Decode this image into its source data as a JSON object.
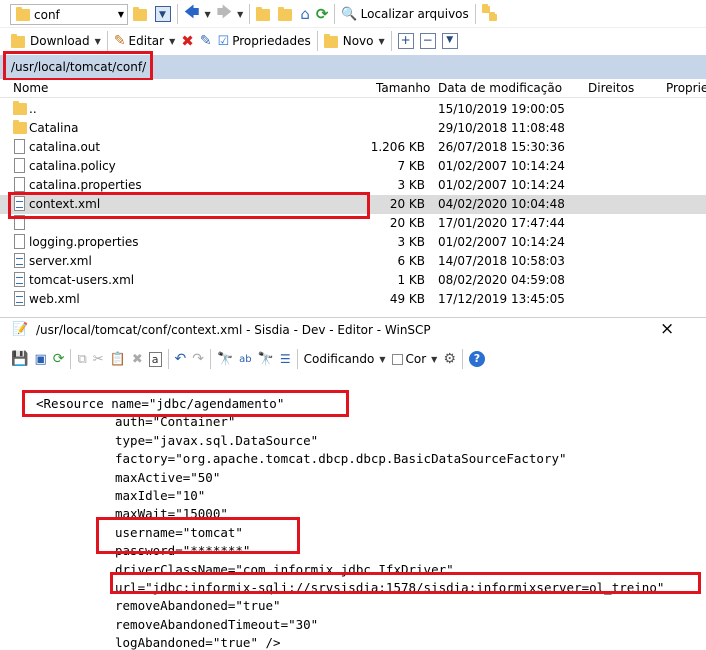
{
  "toolbar1": {
    "location": "conf",
    "find_files": "Localizar arquivos"
  },
  "toolbar2": {
    "download": "Download",
    "edit": "Editar",
    "properties": "Propriedades",
    "new": "Novo"
  },
  "path": "/usr/local/tomcat/conf/",
  "columns": {
    "name": "Nome",
    "size": "Tamanho",
    "modified": "Data de modificação",
    "rights": "Direitos",
    "owner": "Propriet"
  },
  "files": [
    {
      "name": "..",
      "size": "",
      "date": "15/10/2019 19:00:05",
      "kind": "parent"
    },
    {
      "name": "Catalina",
      "size": "",
      "date": "29/10/2018 11:08:48",
      "kind": "folder"
    },
    {
      "name": "catalina.out",
      "size": "1.206 KB",
      "date": "26/07/2018 15:30:36",
      "kind": "file"
    },
    {
      "name": "catalina.policy",
      "size": "7 KB",
      "date": "01/02/2007 10:14:24",
      "kind": "file"
    },
    {
      "name": "catalina.properties",
      "size": "3 KB",
      "date": "01/02/2007 10:14:24",
      "kind": "file"
    },
    {
      "name": "context.xml",
      "size": "20 KB",
      "date": "04/02/2020 10:04:48",
      "kind": "xml"
    },
    {
      "name": "",
      "size": "20 KB",
      "date": "17/01/2020 17:47:44",
      "kind": "file"
    },
    {
      "name": "logging.properties",
      "size": "3 KB",
      "date": "01/02/2007 10:14:24",
      "kind": "file"
    },
    {
      "name": "server.xml",
      "size": "6 KB",
      "date": "14/07/2018 10:58:03",
      "kind": "xml"
    },
    {
      "name": "tomcat-users.xml",
      "size": "1 KB",
      "date": "08/02/2020 04:59:08",
      "kind": "xml"
    },
    {
      "name": "web.xml",
      "size": "49 KB",
      "date": "17/12/2019 13:45:05",
      "kind": "xml"
    }
  ],
  "editor": {
    "title": "/usr/local/tomcat/conf/context.xml - Sisdia - Dev - Editor - WinSCP",
    "encoding": "Codificando",
    "color": "Cor",
    "close": "×",
    "lines": [
      "<Resource name=\"jdbc/agendamento\"",
      "auth=\"Container\"",
      "type=\"javax.sql.DataSource\"",
      "factory=\"org.apache.tomcat.dbcp.dbcp.BasicDataSourceFactory\"",
      "maxActive=\"50\"",
      "maxIdle=\"10\"",
      "maxWait=\"15000\"",
      "username=\"tomcat\"",
      "password=\"*******\"",
      "driverClassName=\"com.informix.jdbc.IfxDriver\"",
      "url=\"jdbc:informix-sqli://srvsisdia:1578/sisdia:informixserver=ol_treino\"",
      "removeAbandoned=\"true\"",
      "removeAbandonedTimeout=\"30\"",
      "logAbandoned=\"true\" />"
    ]
  }
}
